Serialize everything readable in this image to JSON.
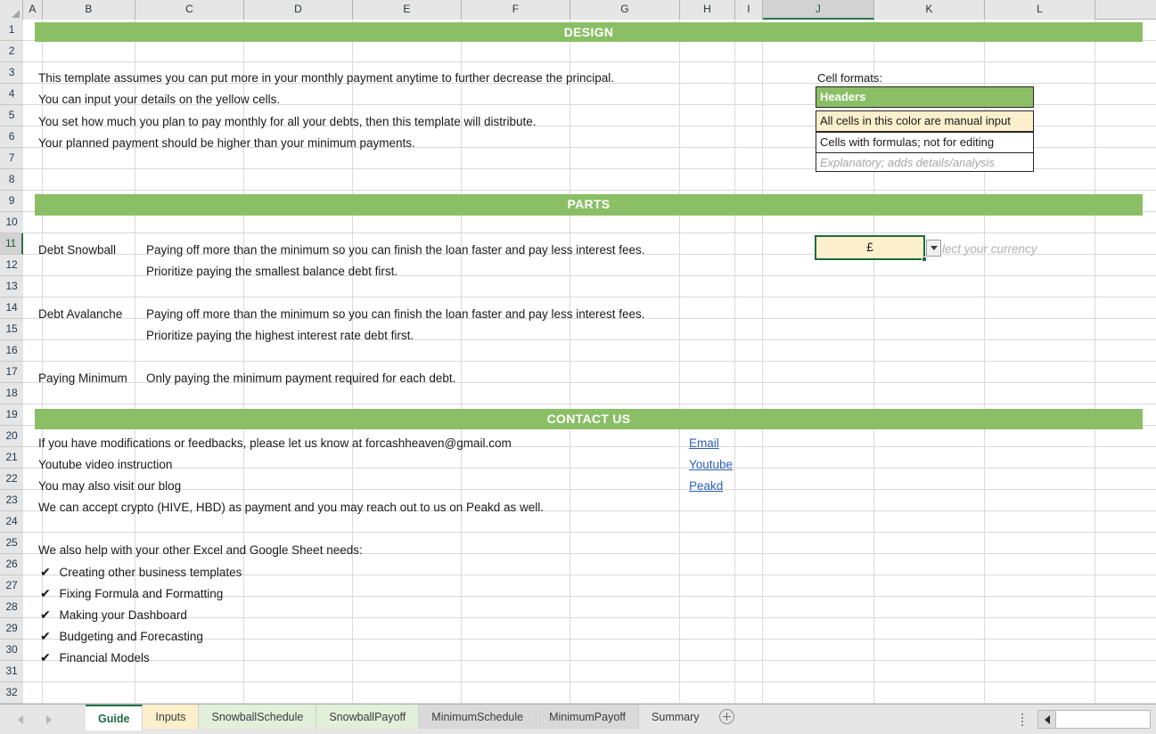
{
  "grid": {
    "columns": [
      "A",
      "B",
      "C",
      "D",
      "E",
      "F",
      "G",
      "H",
      "I",
      "J",
      "K",
      "L"
    ],
    "active_column": "J",
    "active_row": 11,
    "rows": [
      1,
      2,
      3,
      4,
      5,
      6,
      7,
      8,
      9,
      10,
      11,
      12,
      13,
      14,
      15,
      16,
      17,
      18,
      19,
      20,
      21,
      22,
      23,
      24,
      25,
      26,
      27,
      28,
      29,
      30,
      31,
      32
    ]
  },
  "sections": {
    "design_banner": "DESIGN",
    "parts_banner": "PARTS",
    "contact_banner": "CONTACT US"
  },
  "design": {
    "lines": [
      "This template assumes you can put more in your monthly payment anytime to further decrease the principal.",
      "You can input your details on the yellow cells.",
      "You set how much you plan to pay monthly for all your debts, then this template will distribute.",
      "Your planned payment should be higher than your minimum payments."
    ]
  },
  "legend": {
    "title": "Cell formats:",
    "items": [
      {
        "label": "Headers",
        "style": "header"
      },
      {
        "label": "All cells in this color are manual input",
        "style": "input"
      },
      {
        "label": "Cells with formulas; not for editing",
        "style": "formula"
      },
      {
        "label": "Explanatory; adds details/analysis",
        "style": "explanatory"
      }
    ]
  },
  "currency": {
    "value": "£",
    "hint": "lect your currency",
    "full_hint": "Select your currency"
  },
  "parts": [
    {
      "name": "Debt Snowball",
      "desc1": "Paying off more than the minimum so you can finish the loan faster and pay less interest fees.",
      "desc2": "Prioritize paying the smallest balance debt first."
    },
    {
      "name": "Debt Avalanche",
      "desc1": "Paying off more than the minimum so you can finish the loan faster and pay less interest fees.",
      "desc2": "Prioritize paying the highest interest rate debt first."
    },
    {
      "name": "Paying Minimum",
      "desc1": "Only paying the minimum payment required for each debt.",
      "desc2": ""
    }
  ],
  "contact": {
    "lines": [
      "If you have modifications or feedbacks, please let us know at forcashheaven@gmail.com",
      "Youtube video instruction",
      "You may also visit our blog",
      "We can accept crypto (HIVE, HBD) as payment and you may reach out to us on Peakd as well."
    ],
    "links": [
      "Email",
      "Youtube",
      "Peakd"
    ],
    "services_title": "We also help with your other Excel and Google Sheet needs:",
    "services": [
      "Creating other business templates",
      "Fixing Formula and Formatting",
      "Making your Dashboard",
      "Budgeting and Forecasting",
      "Financial Models"
    ],
    "check_glyph": "✔"
  },
  "sheet_tabs": [
    {
      "label": "Guide",
      "style": "active"
    },
    {
      "label": "Inputs",
      "style": "yellow"
    },
    {
      "label": "SnowballSchedule",
      "style": "green"
    },
    {
      "label": "SnowballPayoff",
      "style": "green"
    },
    {
      "label": "MinimumSchedule",
      "style": "grey"
    },
    {
      "label": "MinimumPayoff",
      "style": "grey"
    },
    {
      "label": "Summary",
      "style": "plain"
    }
  ],
  "colors": {
    "banner_green": "#8bbf66",
    "input_yellow": "#fcefcb",
    "selection_green": "#217346",
    "link_blue": "#2b5fb8"
  }
}
